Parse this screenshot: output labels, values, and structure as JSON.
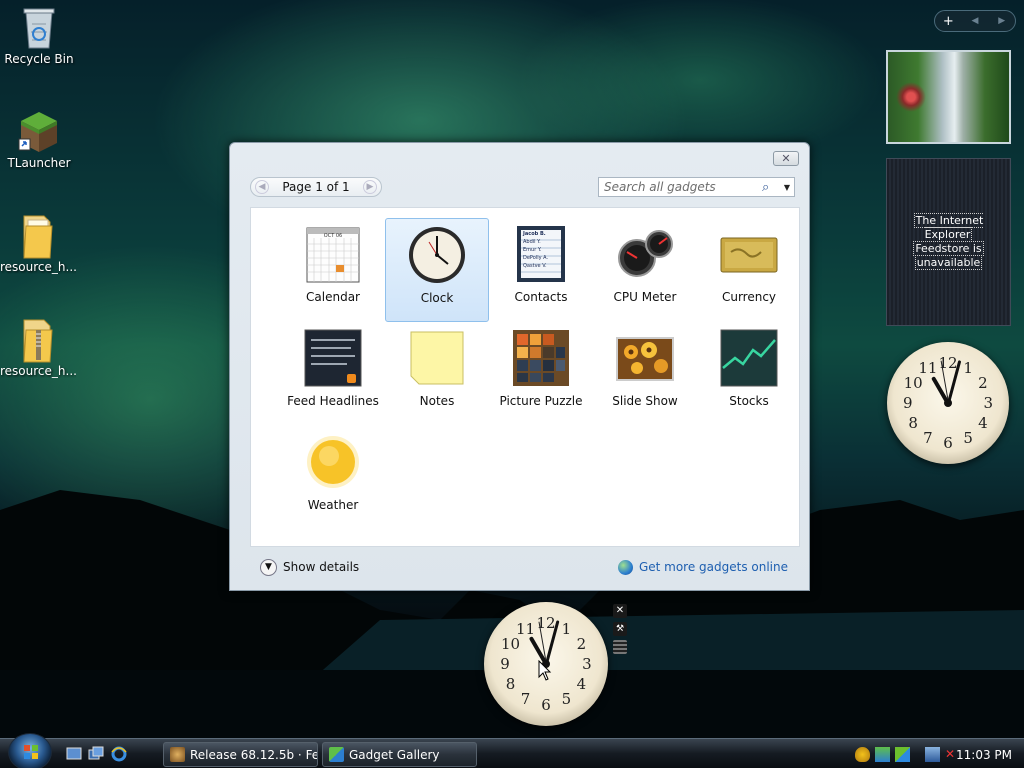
{
  "desktop": {
    "icons": [
      {
        "label": "Recycle Bin"
      },
      {
        "label": "TLauncher"
      },
      {
        "label": "resource_h..."
      },
      {
        "label": "resource_h..."
      }
    ]
  },
  "sidebar": {
    "add_glyph": "+",
    "prev_glyph": "◀",
    "next_glyph": "▶",
    "feed_message_line1": "The Internet Explorer",
    "feed_message_line2": "Feedstore is",
    "feed_message_line3": "unavailable"
  },
  "clock_numerals": [
    "12",
    "1",
    "2",
    "3",
    "4",
    "5",
    "6",
    "7",
    "8",
    "9",
    "10",
    "11"
  ],
  "gallery": {
    "close_glyph": "✕",
    "pager_text": "Page 1 of 1",
    "search_placeholder": "Search all gadgets",
    "gadgets": [
      {
        "label": "Calendar",
        "icon": "calendar-icon"
      },
      {
        "label": "Clock",
        "icon": "clock-icon",
        "selected": true
      },
      {
        "label": "Contacts",
        "icon": "contacts-icon"
      },
      {
        "label": "CPU Meter",
        "icon": "cpu-meter-icon"
      },
      {
        "label": "Currency",
        "icon": "currency-icon"
      },
      {
        "label": "Feed Headlines",
        "icon": "feed-headlines-icon"
      },
      {
        "label": "Notes",
        "icon": "notes-icon"
      },
      {
        "label": "Picture Puzzle",
        "icon": "picture-puzzle-icon"
      },
      {
        "label": "Slide Show",
        "icon": "slide-show-icon"
      },
      {
        "label": "Stocks",
        "icon": "stocks-icon"
      },
      {
        "label": "Weather",
        "icon": "weather-icon"
      }
    ],
    "show_details": "Show details",
    "get_more": "Get more gadgets online"
  },
  "calendar_tile_month": "OCT 06",
  "contacts_tile": [
    "Jacob B.",
    "Abdil Y.",
    "Emur Y.",
    "DePolly A.",
    "Qastve V."
  ],
  "taskbar": {
    "tasks": [
      {
        "label": "Release 68.12.5b · Fe..."
      },
      {
        "label": "Gadget Gallery"
      }
    ],
    "time": "11:03 PM"
  },
  "colors": {
    "link": "#1e5fb0",
    "selection": "#cfe4f9"
  }
}
